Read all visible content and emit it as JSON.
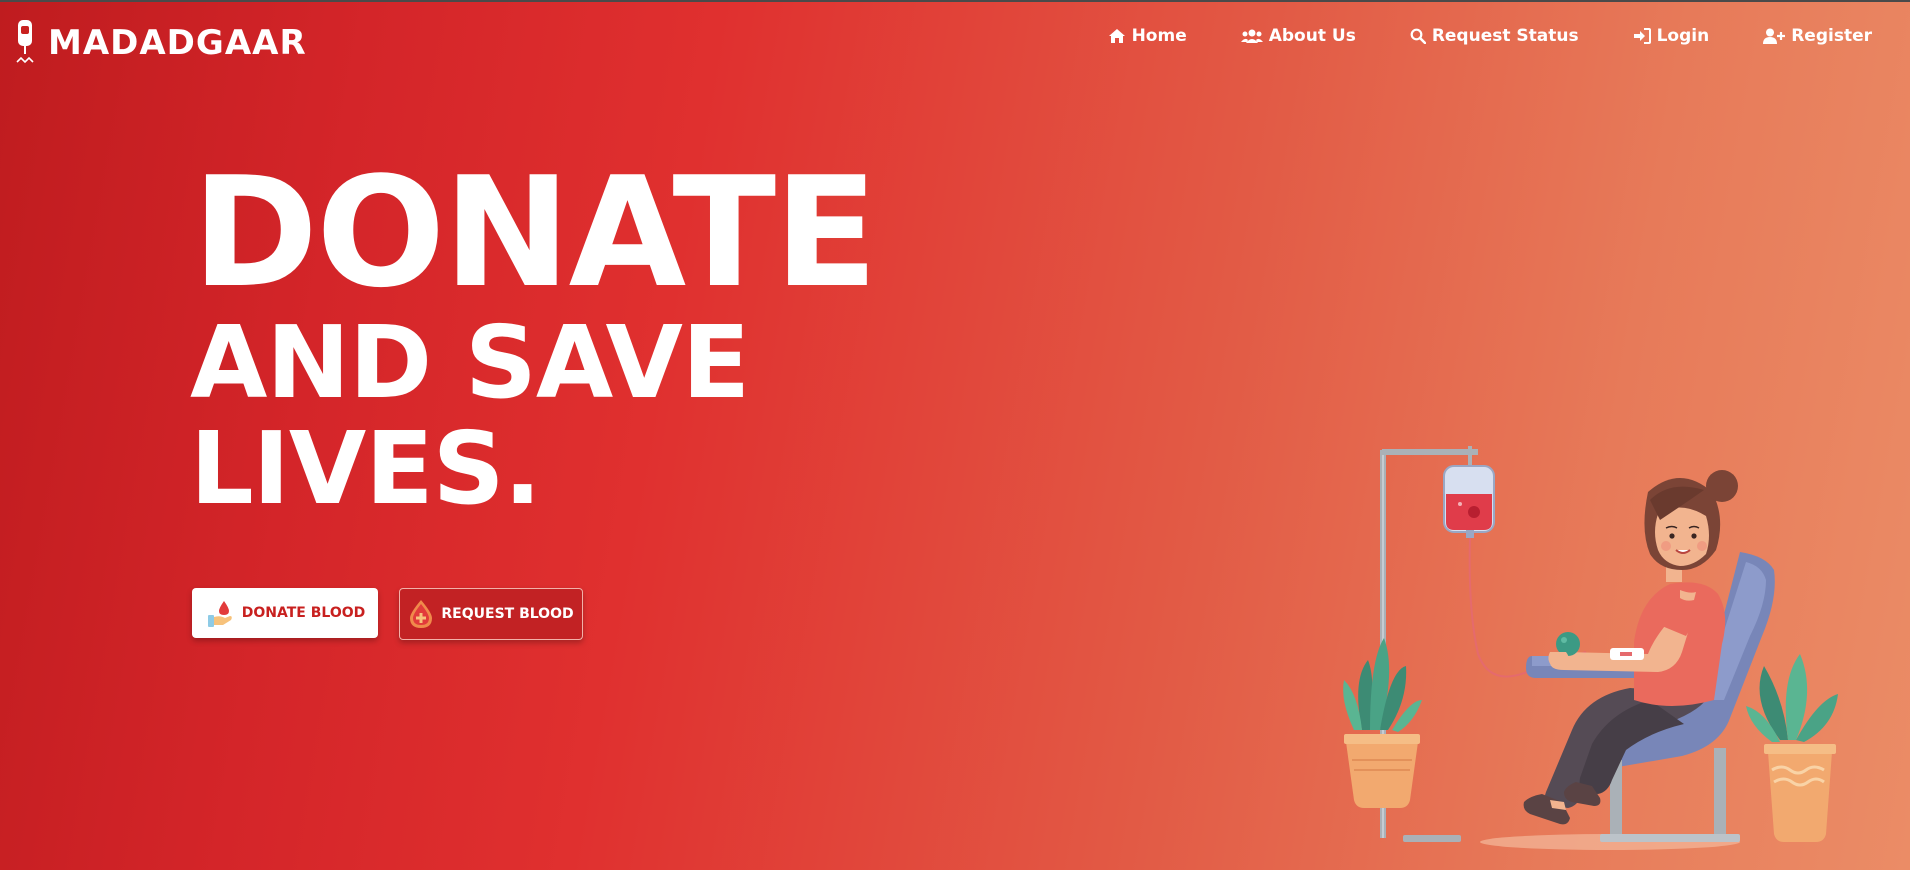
{
  "brand": {
    "name": "MADADGAAR",
    "logo_icon": "blood-bag-icon"
  },
  "nav": {
    "items": [
      {
        "label": "Home",
        "icon": "home-icon"
      },
      {
        "label": "About Us",
        "icon": "users-icon"
      },
      {
        "label": "Request Status",
        "icon": "search-icon"
      },
      {
        "label": "Login",
        "icon": "sign-in-icon"
      },
      {
        "label": "Register",
        "icon": "user-plus-icon"
      }
    ]
  },
  "hero": {
    "line1": "DONATE",
    "line2": "AND SAVE",
    "line3": "LIVES."
  },
  "buttons": {
    "donate_label": "DONATE BLOOD",
    "request_label": "REQUEST BLOOD"
  },
  "colors": {
    "gradient_start": "#bf1c1f",
    "gradient_end": "#eb8c66",
    "accent_red": "#c8201f",
    "text_white": "#ffffff"
  }
}
